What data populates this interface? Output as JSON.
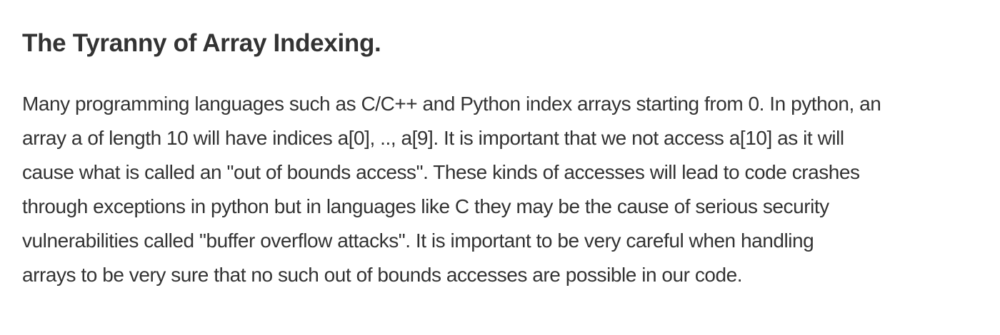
{
  "article": {
    "title": "The Tyranny of Array Indexing.",
    "paragraph_lines": [
      "Many programming languages such as C/C++ and Python index arrays starting from 0.  In python, an",
      "array a of length 10 will have indices a[0], .., a[9]. It is important that we not access a[10] as it will",
      "cause what is called an \"out of bounds access\". These kinds of accesses will lead to code crashes",
      "through exceptions in python but in languages like C they may be the cause of serious security",
      "vulnerabilities called \"buffer overflow attacks\". It is important to be very careful when handling",
      "arrays to be very sure that no such out of bounds accesses are possible in our code."
    ]
  }
}
